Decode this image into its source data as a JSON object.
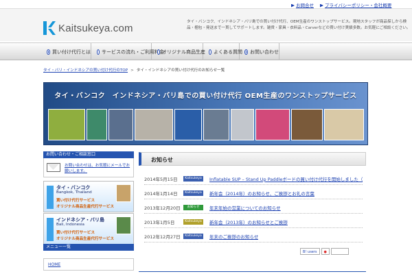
{
  "top_links": [
    {
      "label": "お問合せ"
    },
    {
      "label": "プライバシーポリシー・会社概要"
    }
  ],
  "logo": {
    "text": "Kaitsukeya.com",
    "brand_color": "#1596d8"
  },
  "header_description": "タイ・バンコク、インドネシア・バリ島での買い付け代行、OEM生産のワンストップサービス。現地スタッフが商品探しから検品・梱包・発送まで一貫してサポートします。雑貨・家具・衣料品・Carverなどの買い付け実績多数。お気軽にご相談ください。",
  "nav": [
    {
      "label": "買い付け代行とは"
    },
    {
      "label": "サービスの流れ・ご利用料金"
    },
    {
      "label": "オリジナル商品生産"
    },
    {
      "label": "よくある質問"
    },
    {
      "label": "お問い合わせ"
    }
  ],
  "breadcrumb": {
    "home": "タイ・バリ・インドネシアの買い付け代行のTOP",
    "separator": ">",
    "current": "タイ・インドネシアの買い付け代行のお知らせ一覧"
  },
  "banner": {
    "title": "タイ・バンコク　インドネシア・バリ島での買い付け代行 OEM生産のワンストップサービス",
    "photo_colors": [
      "#8fae3f",
      "#3e8a6a",
      "#5a6f8e",
      "#b7b2a8",
      "#2a5ea8",
      "#6a7c92",
      "#c2c6cc",
      "#d24a7a",
      "#7a5a3a",
      "#d9c9a7"
    ]
  },
  "sidebar": {
    "contact_heading": "お問い合わせ・ご相談窓口",
    "contact_link": "お問い合わせは、お気軽にメールでお願いします。",
    "regions": [
      {
        "name": "タイ・バンコク",
        "sub": "Bangkok, Thailand",
        "line1": "買い付け代行サービス",
        "line2": "オリジナル商品生産代行サービス"
      },
      {
        "name": "インドネシア・バリ島",
        "sub": "Bali, Indonesia",
        "line1": "買い付け代行サービス",
        "line2": "オリジナル商品生産代行サービス"
      }
    ],
    "menu_heading": "メニュー一覧",
    "home_link": "HOME"
  },
  "content": {
    "title": "お知らせ",
    "news": [
      {
        "date": "2014年5月15日",
        "tag": "Kaitsukeya",
        "tag_color": "#3b5fb0",
        "text": "Inflatable SUP – Stand Up Paddleボードの買い付け代行を開始しました（ス...（出典）"
      },
      {
        "date": "2014年1月14日",
        "tag": "Kaitsukeya",
        "tag_color": "#3b5fb0",
        "text": "新年会（2014年）のお知らせ、ご挨拶とお礼の言葉"
      },
      {
        "date": "2013年12月20日",
        "tag": "お知らせ",
        "tag_color": "#2f9a3a",
        "text": "年末年始の営業についてのお知らせ"
      },
      {
        "date": "2013年1月5日",
        "tag": "Kaitsukeya",
        "tag_color": "#b0a02a",
        "text": "新年会（2013年）のお知らせとご挨拶"
      },
      {
        "date": "2012年12月27日",
        "tag": "Kaitsukeya",
        "tag_color": "#3b5fb0",
        "text": "年末のご挨拶のお知らせ"
      }
    ]
  },
  "share": {
    "bookmark_label": "B! users"
  }
}
